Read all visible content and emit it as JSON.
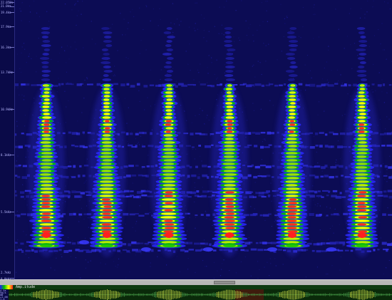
{
  "freq_axis": {
    "labels": [
      "22.050k",
      "21.0km",
      "19.4km",
      "17.9km",
      "16.3km",
      "13.7kHz",
      "10.9kHz",
      "8.1kHz",
      "5.5kHz",
      "2.7kHz",
      "0.0kHz"
    ]
  },
  "amplitude": {
    "label": "Amp.itude",
    "side_labels": [
      "4.5s",
      "Vm/s",
      "dB",
      "+1.00",
      "1.0"
    ]
  },
  "colors": {
    "background": "#0c0c54",
    "low": "#2a2aff",
    "mid": "#00c000",
    "high": "#ffff00",
    "peak": "#ff2020"
  }
}
